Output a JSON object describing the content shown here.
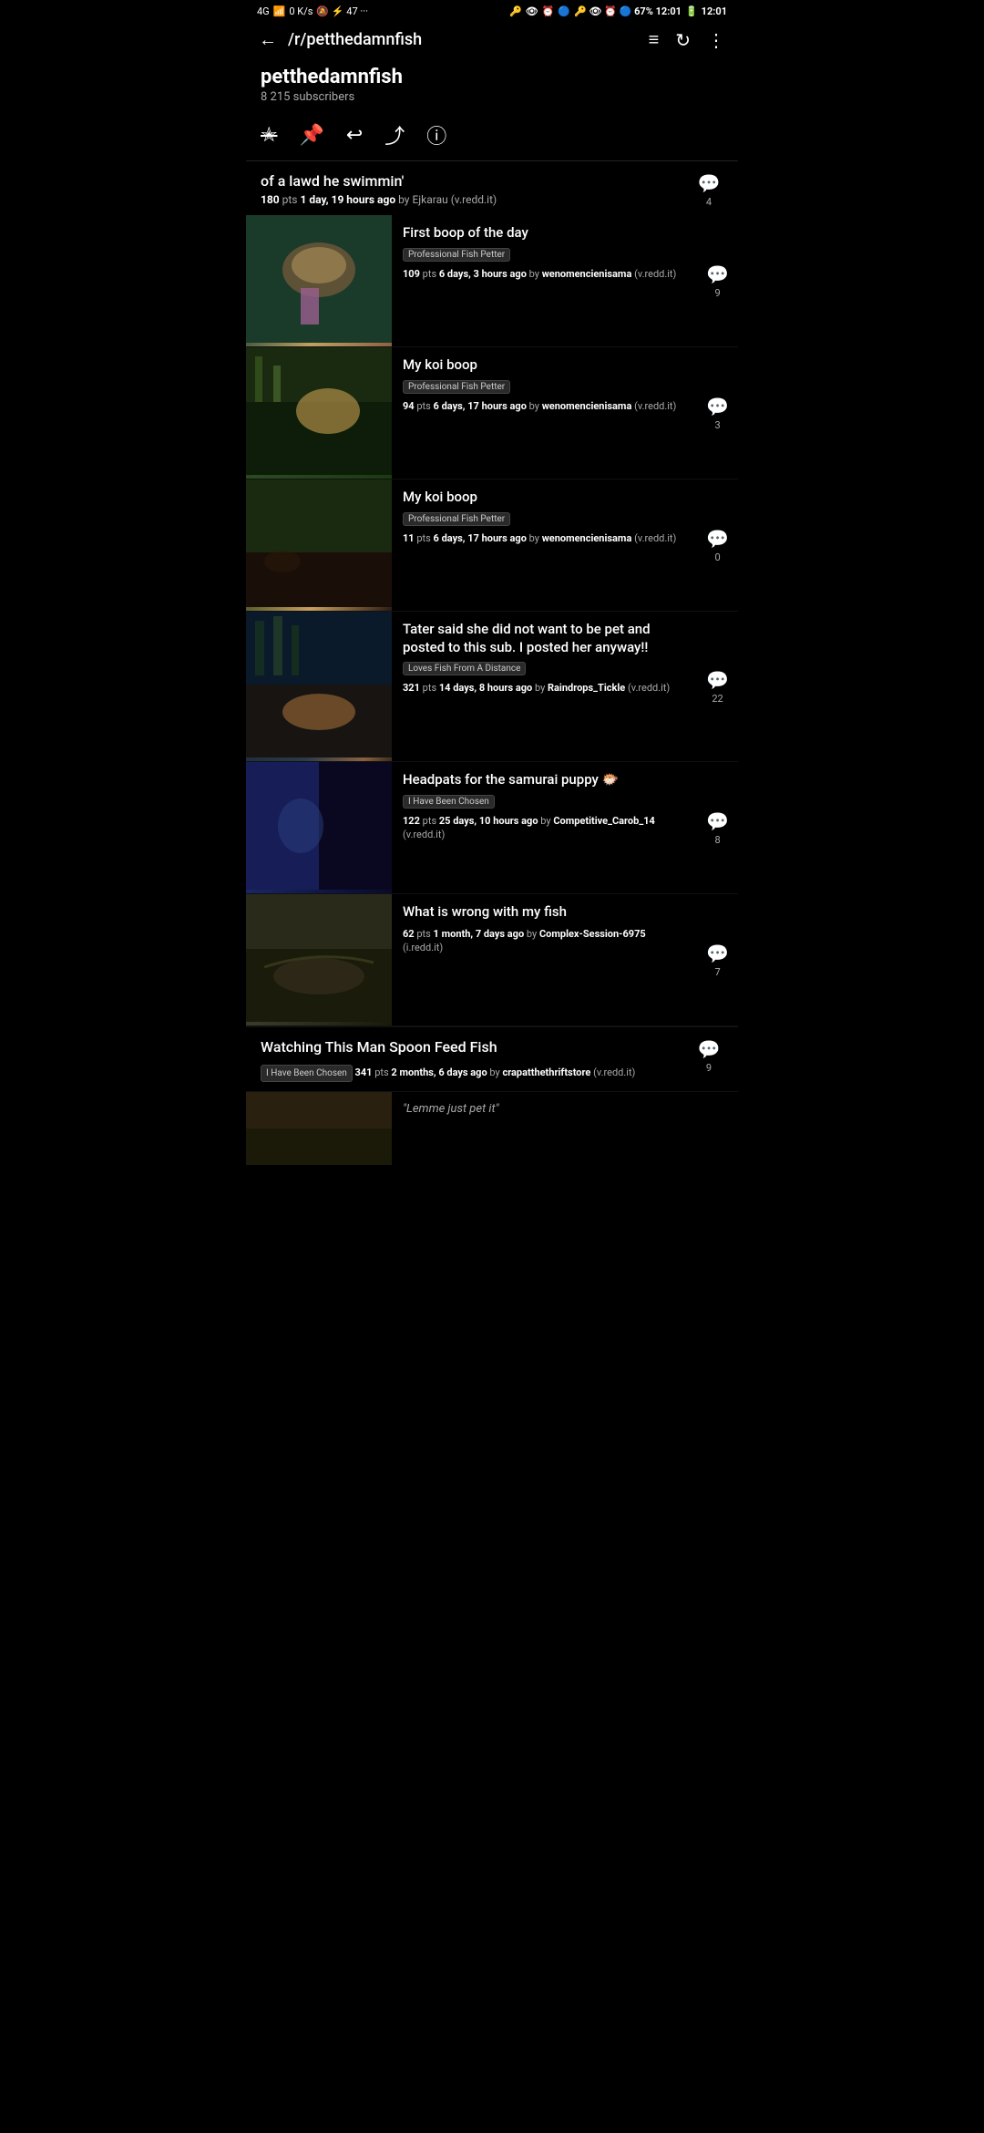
{
  "statusBar": {
    "left": "4G  ↑↓  0 K/s",
    "icons": "🔕 ☁ ⚡ 47 📧 ···",
    "right": "🔑 👁 ⏰ 🔵 67%  12:01"
  },
  "topNav": {
    "backLabel": "←",
    "title": "/r/petthedamnfish",
    "filterIcon": "≡",
    "refreshIcon": "↻",
    "moreIcon": "⋮"
  },
  "subHeader": {
    "name": "petthedamnfish",
    "subscribers": "8 215 subscribers"
  },
  "actionBar": {
    "starIcon": "✭",
    "pinIcon": "📌",
    "replyIcon": "↩",
    "shareIcon": "⤴",
    "infoIcon": "ⓘ"
  },
  "firstPost": {
    "title": "of a lawd he swimmin'",
    "pts": "180",
    "ptsLabel": "pts",
    "time": "1 day, 19 hours ago",
    "byLabel": "by",
    "author": "Ejkarau",
    "domain": "(v.redd.it)",
    "commentCount": "4"
  },
  "posts": [
    {
      "id": 1,
      "thumbClass": "thumb-1",
      "title": "First boop of the day",
      "flair": "Professional Fish Petter",
      "pts": "109",
      "time": "6 days, 3 hours ago",
      "author": "wenomencienisama",
      "domain": "(v.redd.it)",
      "commentCount": "9"
    },
    {
      "id": 2,
      "thumbClass": "thumb-2",
      "title": "My koi boop",
      "flair": "Professional Fish Petter",
      "pts": "94",
      "time": "6 days, 17 hours ago",
      "author": "wenomencienisama",
      "domain": "(v.redd.it)",
      "commentCount": "3"
    },
    {
      "id": 3,
      "thumbClass": "thumb-3",
      "title": "My koi boop",
      "flair": "Professional Fish Petter",
      "pts": "11",
      "time": "6 days, 17 hours ago",
      "author": "wenomencienisama",
      "domain": "(v.redd.it)",
      "commentCount": "0"
    },
    {
      "id": 4,
      "thumbClass": "thumb-4",
      "title": "Tater said she did not want to be pet and posted to this sub. I posted her anyway!!",
      "flair": "Loves Fish From A Distance",
      "pts": "321",
      "time": "14 days, 8 hours ago",
      "author": "Raindrops_Tickle",
      "domain": "(v.redd.it)",
      "commentCount": "22"
    },
    {
      "id": 5,
      "thumbClass": "thumb-5",
      "title": "Headpats for the samurai puppy 🐡",
      "flair": "I Have Been Chosen",
      "pts": "122",
      "time": "25 days, 10 hours ago",
      "author": "Competitive_Carob_14",
      "domain": "(v.redd.it)",
      "commentCount": "8"
    },
    {
      "id": 6,
      "thumbClass": "thumb-6",
      "title": "What is wrong with my fish",
      "flair": "",
      "pts": "62",
      "time": "1 month, 7 days ago",
      "author": "Complex-Session-6975",
      "domain": "(i.redd.it)",
      "commentCount": "7"
    }
  ],
  "bottomPost": {
    "title": "Watching This Man Spoon Feed Fish",
    "flair": "I Have Been Chosen",
    "pts": "341",
    "time": "2 months, 6 days ago",
    "author": "crapatthethriftstore",
    "domain": "(v.redd.it)",
    "commentCount": "9"
  },
  "partialPost": {
    "quoteText": "\"Lemme just pet it\""
  }
}
